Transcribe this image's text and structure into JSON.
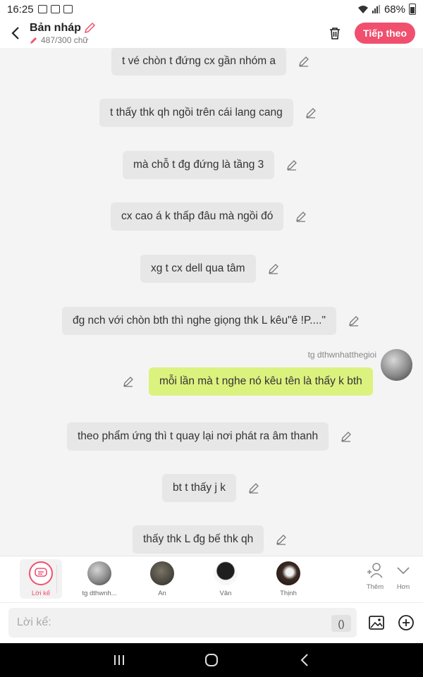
{
  "status": {
    "time": "16:25",
    "battery": "68%"
  },
  "header": {
    "title": "Bản nháp",
    "word_count": "487/300 chữ",
    "next_button": "Tiếp theo"
  },
  "messages": [
    {
      "text": "t vé chòn t đứng cx gần nhóm a",
      "me": false
    },
    {
      "text": "t thấy thk qh ngồi trên cái lang cang",
      "me": false
    },
    {
      "text": "mà chỗ t đg đứng là tầng 3",
      "me": false
    },
    {
      "text": "cx cao á k thấp đâu mà ngồi đó",
      "me": false
    },
    {
      "text": "xg t cx dell qua tâm",
      "me": false
    },
    {
      "text": "đg nch với chòn bth thì nghe giọng thk L kêu\"ê !P....\"",
      "me": false
    },
    {
      "text": "mỗi lần mà t nghe nó kêu tên là thấy k bth",
      "me": true,
      "author": "tg dthwnhatthegioi"
    },
    {
      "text": "theo phẩm ứng thì t quay lại nơi phát ra âm thanh",
      "me": false
    },
    {
      "text": "bt t thấy j k",
      "me": false
    },
    {
      "text": "thấy thk L đg bế thk qh",
      "me": false
    }
  ],
  "characters": [
    {
      "name": "Lời kể",
      "selected": true
    },
    {
      "name": "tg dthwnh..."
    },
    {
      "name": "An"
    },
    {
      "name": "Vân"
    },
    {
      "name": "Thịnh"
    }
  ],
  "more": {
    "add_label": "Thêm",
    "more_label": "Hơn"
  },
  "input": {
    "placeholder": "Lời kể:",
    "paren_label": "()"
  },
  "colors": {
    "accent": "#f0506e",
    "my_bubble": "#dcf27e",
    "bubble": "#e7e7e7"
  }
}
